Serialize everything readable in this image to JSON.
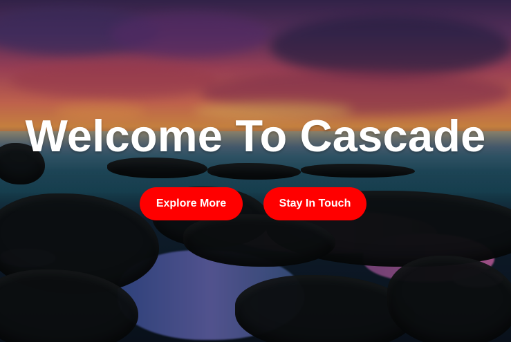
{
  "hero": {
    "title": "Welcome To Cascade",
    "buttons": [
      {
        "label": "Explore More"
      },
      {
        "label": "Stay In Touch"
      }
    ]
  },
  "colors": {
    "button_background": "#ff0000",
    "button_text": "#ffffff",
    "title_text": "#ffffff"
  }
}
